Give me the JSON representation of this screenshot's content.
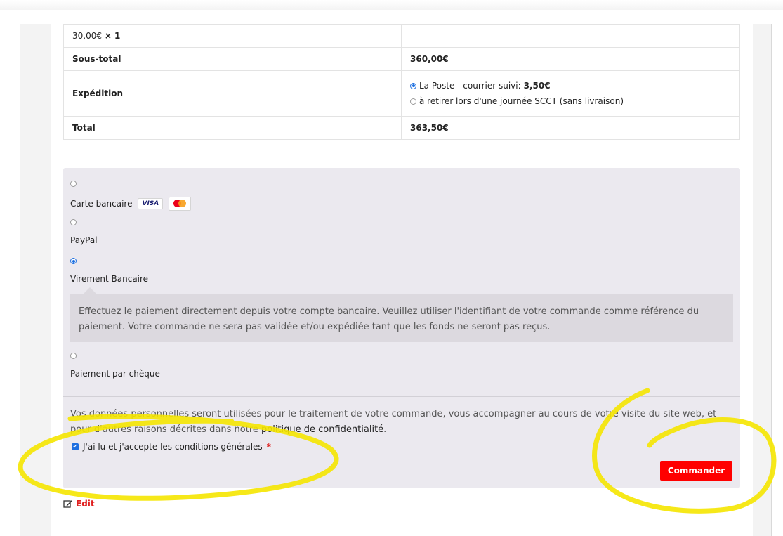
{
  "totals": {
    "item_price": "30,00€",
    "item_qty": "× 1",
    "subtotal_label": "Sous-total",
    "subtotal_value": "360,00€",
    "shipping_label": "Expédition",
    "shipping_options": [
      {
        "label": "La Poste - courrier suivi:",
        "price": "3,50€",
        "selected": true
      },
      {
        "label": "à retirer lors d'une journée SCCT (sans livraison)",
        "selected": false
      }
    ],
    "total_label": "Total",
    "total_value": "363,50€"
  },
  "payment": {
    "methods": [
      {
        "label": "Carte bancaire",
        "selected": false,
        "badges": [
          "VISA",
          "mastercard"
        ]
      },
      {
        "label": "PayPal",
        "selected": false
      },
      {
        "label": "Virement Bancaire",
        "selected": true
      },
      {
        "label": "Paiement par chèque",
        "selected": false
      }
    ],
    "bank_transfer_description": "Effectuez le paiement directement depuis votre compte bancaire. Veuillez utiliser l'identifiant de votre commande comme référence du paiement. Votre commande ne sera pas validée et/ou expédiée tant que les fonds ne seront pas reçus.",
    "privacy_text": "Vos données personnelles seront utilisées pour le traitement de votre commande, vous accompagner au cours de votre visite du site web, et pour d'autres raisons décrites dans notre",
    "privacy_link": "politique de confidentialité",
    "privacy_end": ".",
    "terms_label": "J'ai lu et j'accepte les conditions générales",
    "terms_required": "*",
    "terms_checked": true,
    "order_button": "Commander"
  },
  "edit_link": "Edit",
  "colors": {
    "accent_button": "#ff0000",
    "radio_selected": "#1d6fe0",
    "annotation_highlight": "#f5e600"
  }
}
